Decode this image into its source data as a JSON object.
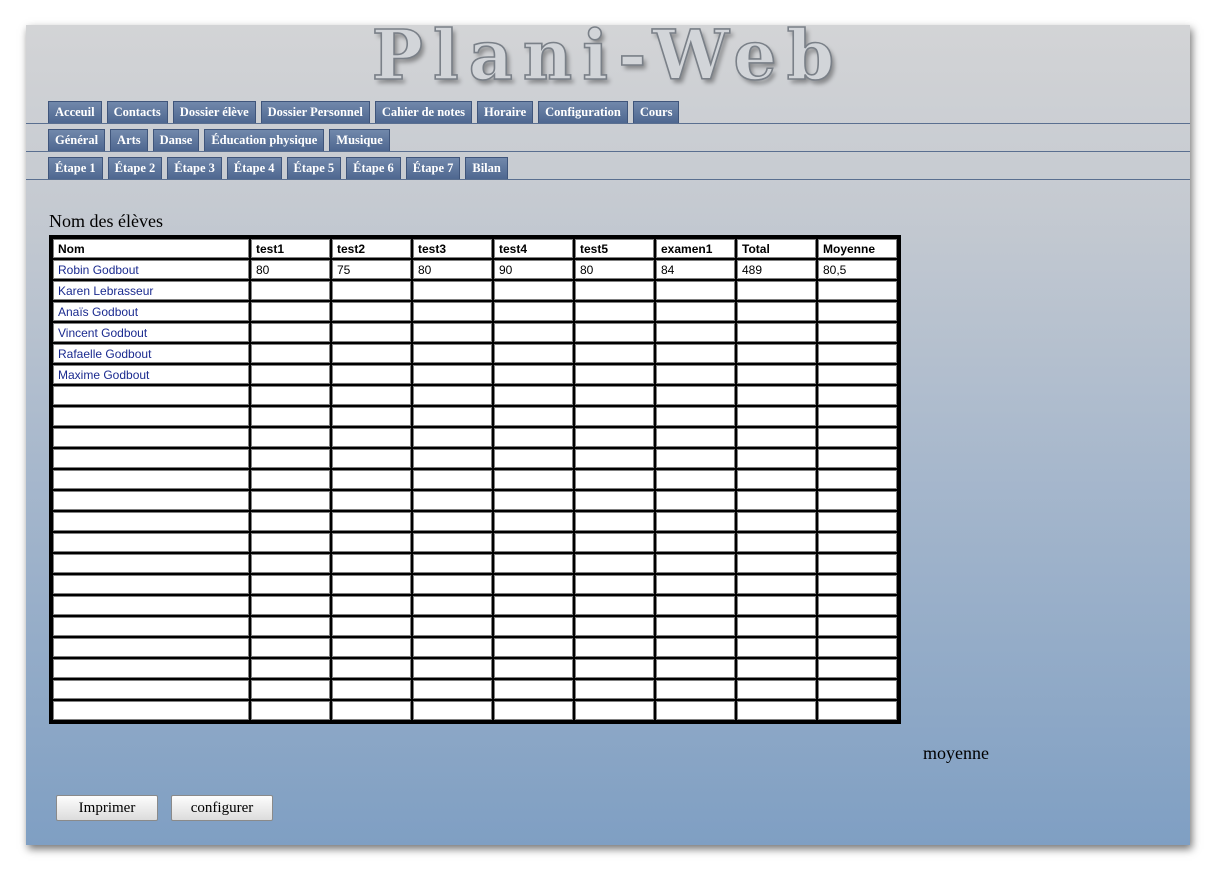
{
  "app": {
    "logo": "Plani-Web"
  },
  "nav": {
    "main_tabs": [
      "Acceuil",
      "Contacts",
      "Dossier élève",
      "Dossier Personnel",
      "Cahier de notes",
      "Horaire",
      "Configuration",
      "Cours"
    ],
    "subject_tabs": [
      "Général",
      "Arts",
      "Danse",
      "Éducation physique",
      "Musique"
    ],
    "stage_tabs": [
      "Étape 1",
      "Étape 2",
      "Étape 3",
      "Étape 4",
      "Étape 5",
      "Étape 6",
      "Étape 7",
      "Bilan"
    ]
  },
  "grades": {
    "section_title": "Nom des élèves",
    "columns": [
      "Nom",
      "test1",
      "test2",
      "test3",
      "test4",
      "test5",
      "examen1",
      "Total",
      "Moyenne"
    ],
    "rows": [
      [
        "Robin Godbout",
        "80",
        "75",
        "80",
        "90",
        "80",
        "84",
        "489",
        "80,5"
      ],
      [
        "Karen Lebrasseur",
        "",
        "",
        "",
        "",
        "",
        "",
        "",
        ""
      ],
      [
        "Anaïs Godbout",
        "",
        "",
        "",
        "",
        "",
        "",
        "",
        ""
      ],
      [
        "Vincent Godbout",
        "",
        "",
        "",
        "",
        "",
        "",
        "",
        ""
      ],
      [
        "Rafaelle Godbout",
        "",
        "",
        "",
        "",
        "",
        "",
        "",
        ""
      ],
      [
        "Maxime Godbout",
        "",
        "",
        "",
        "",
        "",
        "",
        "",
        ""
      ]
    ],
    "empty_row_count": 16,
    "average_label": "moyenne"
  },
  "actions": {
    "print_label": "Imprimer",
    "configure_label": "configurer"
  },
  "colors": {
    "tab_bg": "#5a729b",
    "link_text": "#1a2a8f",
    "background_top": "#d3d4d6",
    "background_bottom": "#7f9fc3"
  }
}
